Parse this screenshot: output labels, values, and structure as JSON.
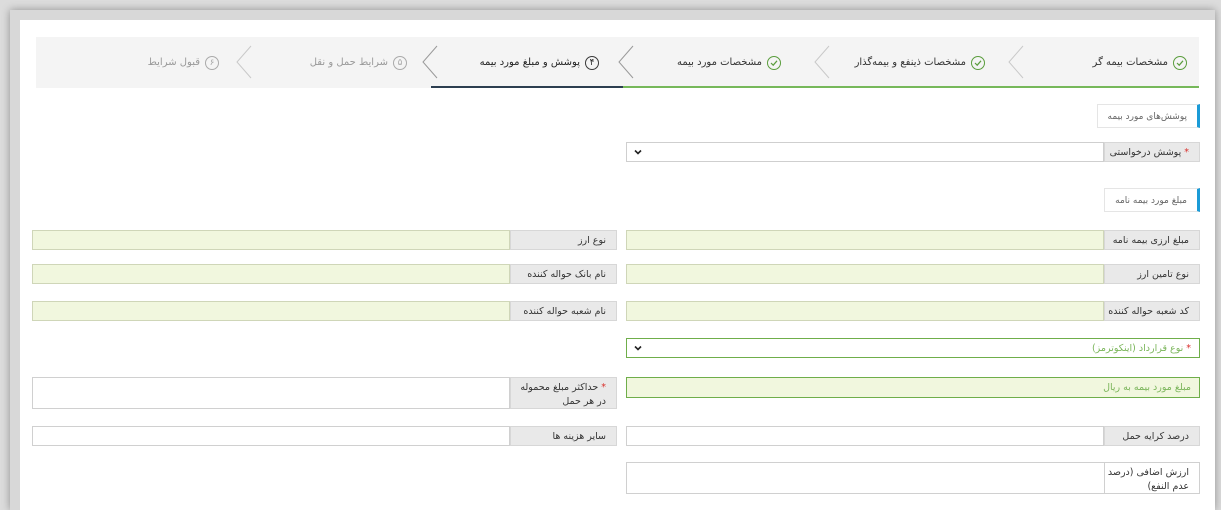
{
  "steps": [
    {
      "label": "مشخصات بیمه گر",
      "num": "",
      "state": "done"
    },
    {
      "label": "مشخصات ذینفع و بیمه‌گذار",
      "num": "",
      "state": "done"
    },
    {
      "label": "مشخصات مورد بیمه",
      "num": "",
      "state": "done"
    },
    {
      "label": "پوشش و مبلغ مورد بیمه",
      "num": "۴",
      "state": "active"
    },
    {
      "label": "شرایط حمل و نقل",
      "num": "۵",
      "state": "todo"
    },
    {
      "label": "قبول شرایط",
      "num": "۶",
      "state": "todo"
    }
  ],
  "colors": {
    "accent": "#1b9bd7",
    "done": "#5a9d3c",
    "active": "#2c3e50",
    "field_bg": "#f1f7de"
  },
  "section1": {
    "title": "پوشش‌های مورد بیمه"
  },
  "coverage": {
    "label": "پوشش درخواستی",
    "required_mark": "*"
  },
  "section2": {
    "title": "مبلغ مورد بیمه نامه"
  },
  "fields": {
    "currency_amount": "مبلغ ارزی بیمه نامه",
    "currency_type": "نوع ارز",
    "currency_supply_type": "نوع تامین ارز",
    "remitter_bank": "نام بانک حواله کننده",
    "remitter_branch_code": "کد شعبه حواله کننده",
    "remitter_branch_name": "نام شعبه حواله کننده",
    "contract_type": "نوع قرارداد (اینکوترمز)",
    "amount_rial": "مبلغ مورد بیمه به ریال",
    "max_cargo_line1": "حداکثر مبلغ محموله",
    "max_cargo_line2": "در هر حمل",
    "freight_percent": "درصد کرایه حمل",
    "other_costs": "سایر هزینه ها",
    "added_value_line1": "ارزش اضافی (درصد",
    "added_value_line2": "عدم النفع)"
  }
}
